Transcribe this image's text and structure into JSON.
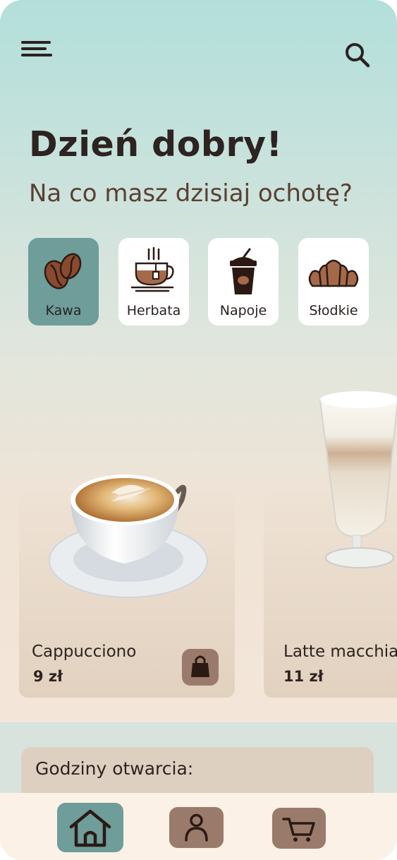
{
  "header": {
    "menu_icon": "menu-icon",
    "search_icon": "search-icon"
  },
  "greeting": "Dzień dobry!",
  "subtitle": "Na co masz dzisiaj ochotę?",
  "categories": [
    {
      "label": "Kawa",
      "icon": "coffee-beans-icon",
      "active": true
    },
    {
      "label": "Herbata",
      "icon": "tea-cup-icon",
      "active": false
    },
    {
      "label": "Napoje",
      "icon": "drink-cup-icon",
      "active": false
    },
    {
      "label": "Słodkie",
      "icon": "croissant-icon",
      "active": false
    }
  ],
  "products": [
    {
      "name": "Cappucciono",
      "price": "9 zł",
      "image": "cappuccino-cup-image",
      "cart_icon": "shopping-bag-icon"
    },
    {
      "name": "Latte macchiato",
      "price": "11 zł",
      "image": "latte-glass-image"
    }
  ],
  "hours": {
    "title": "Godziny otwarcia:"
  },
  "bottom_nav": [
    {
      "icon": "home-icon",
      "active": true
    },
    {
      "icon": "user-icon",
      "active": false
    },
    {
      "icon": "cart-icon",
      "active": false
    }
  ],
  "colors": {
    "accent_teal": "#6e9d9a",
    "brown_button": "#9a7b6b",
    "dark_text": "#2d2320",
    "subtitle_brown": "#5a4032",
    "card_beige": "#e2d1bf",
    "nav_bg": "#fbf1e6"
  }
}
